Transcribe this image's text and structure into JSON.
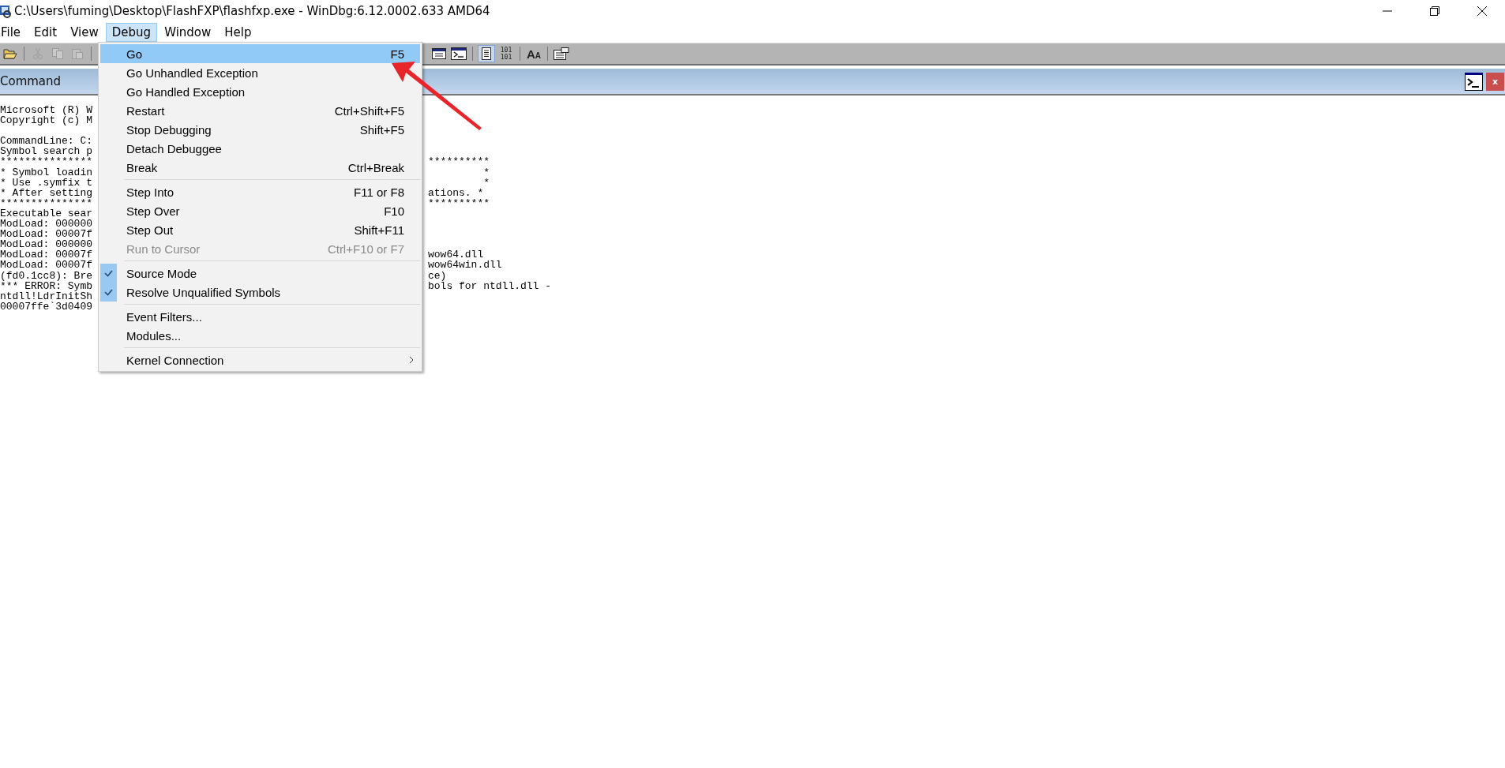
{
  "window": {
    "title": "C:\\Users\\fuming\\Desktop\\FlashFXP\\flashfxp.exe - WinDbg:6.12.0002.633 AMD64"
  },
  "menu_bar": [
    {
      "label": "File",
      "selected": false
    },
    {
      "label": "Edit",
      "selected": false
    },
    {
      "label": "View",
      "selected": false
    },
    {
      "label": "Debug",
      "selected": true
    },
    {
      "label": "Window",
      "selected": false
    },
    {
      "label": "Help",
      "selected": false
    }
  ],
  "toolbar": {
    "left": [
      {
        "kind": "open",
        "disabled": false,
        "pressed": false
      },
      {
        "kind": "sep"
      },
      {
        "kind": "cut",
        "disabled": true,
        "pressed": false
      },
      {
        "kind": "copy",
        "disabled": true,
        "pressed": false
      },
      {
        "kind": "paste",
        "disabled": true,
        "pressed": false
      },
      {
        "kind": "sep"
      }
    ],
    "right": [
      {
        "kind": "window",
        "disabled": false,
        "pressed": false
      },
      {
        "kind": "command",
        "disabled": false,
        "pressed": false
      },
      {
        "kind": "sep"
      },
      {
        "kind": "source",
        "disabled": false,
        "pressed": true
      },
      {
        "kind": "binary",
        "lines": [
          "101",
          "101"
        ],
        "disabled": false,
        "pressed": false
      },
      {
        "kind": "sep"
      },
      {
        "kind": "font",
        "letters": [
          "A",
          "A"
        ],
        "disabled": false,
        "pressed": false
      },
      {
        "kind": "sep"
      },
      {
        "kind": "options",
        "disabled": false,
        "pressed": false
      }
    ]
  },
  "command_window": {
    "title": "Command",
    "close_label": "x"
  },
  "console": {
    "blocks": [
      [
        {
          "left": "Microsoft (R) W"
        },
        {
          "left": "Copyright (c) M"
        }
      ],
      [
        {
          "left": "CommandLine: C:"
        },
        {
          "left": "Symbol search p"
        },
        {
          "left": "***************",
          "right": "**********"
        },
        {
          "left": "* Symbol loadin",
          "right": "         *"
        },
        {
          "left": "* Use .symfix t",
          "right": "         *"
        },
        {
          "left": "* After setting",
          "right": "ations. *"
        },
        {
          "left": "***************",
          "right": "**********"
        },
        {
          "left": "Executable sear"
        },
        {
          "left": "ModLoad: 000000"
        },
        {
          "left": "ModLoad: 00007f"
        },
        {
          "left": "ModLoad: 000000"
        },
        {
          "left": "ModLoad: 00007f",
          "right": "wow64.dll"
        },
        {
          "left": "ModLoad: 00007f",
          "right": "wow64win.dll"
        },
        {
          "left": "(fd0.1cc8): Bre",
          "right": "ce)"
        },
        {
          "left": "*** ERROR: Symb",
          "right": "bols for ntdll.dll -"
        },
        {
          "left": "ntdll!LdrInitSh"
        },
        {
          "left": "00007ffe`3d0409"
        }
      ]
    ]
  },
  "debug_menu": {
    "groups": [
      [
        {
          "label": "Go",
          "shortcut": "F5",
          "selected": true,
          "disabled": false,
          "checked": false,
          "submenu": false
        },
        {
          "label": "Go Unhandled Exception",
          "selected": false,
          "disabled": false,
          "checked": false,
          "submenu": false
        },
        {
          "label": "Go Handled Exception",
          "selected": false,
          "disabled": false,
          "checked": false,
          "submenu": false
        },
        {
          "label": "Restart",
          "shortcut": "Ctrl+Shift+F5",
          "selected": false,
          "disabled": false,
          "checked": false,
          "submenu": false
        },
        {
          "label": "Stop Debugging",
          "shortcut": "Shift+F5",
          "selected": false,
          "disabled": false,
          "checked": false,
          "submenu": false
        },
        {
          "label": "Detach Debuggee",
          "selected": false,
          "disabled": false,
          "checked": false,
          "submenu": false
        },
        {
          "label": "Break",
          "shortcut": "Ctrl+Break",
          "selected": false,
          "disabled": false,
          "checked": false,
          "submenu": false
        }
      ],
      [
        {
          "label": "Step Into",
          "shortcut": "F11 or F8",
          "selected": false,
          "disabled": false,
          "checked": false,
          "submenu": false
        },
        {
          "label": "Step Over",
          "shortcut": "F10",
          "selected": false,
          "disabled": false,
          "checked": false,
          "submenu": false
        },
        {
          "label": "Step Out",
          "shortcut": "Shift+F11",
          "selected": false,
          "disabled": false,
          "checked": false,
          "submenu": false
        },
        {
          "label": "Run to Cursor",
          "shortcut": "Ctrl+F10 or F7",
          "selected": false,
          "disabled": true,
          "checked": false,
          "submenu": false
        }
      ],
      [
        {
          "label": "Source Mode",
          "selected": false,
          "disabled": false,
          "checked": true,
          "submenu": false
        },
        {
          "label": "Resolve Unqualified Symbols",
          "selected": false,
          "disabled": false,
          "checked": true,
          "submenu": false
        }
      ],
      [
        {
          "label": "Event Filters...",
          "selected": false,
          "disabled": false,
          "checked": false,
          "submenu": false
        },
        {
          "label": "Modules...",
          "selected": false,
          "disabled": false,
          "checked": false,
          "submenu": false
        }
      ],
      [
        {
          "label": "Kernel Connection",
          "selected": false,
          "disabled": false,
          "checked": false,
          "submenu": true
        }
      ]
    ]
  }
}
